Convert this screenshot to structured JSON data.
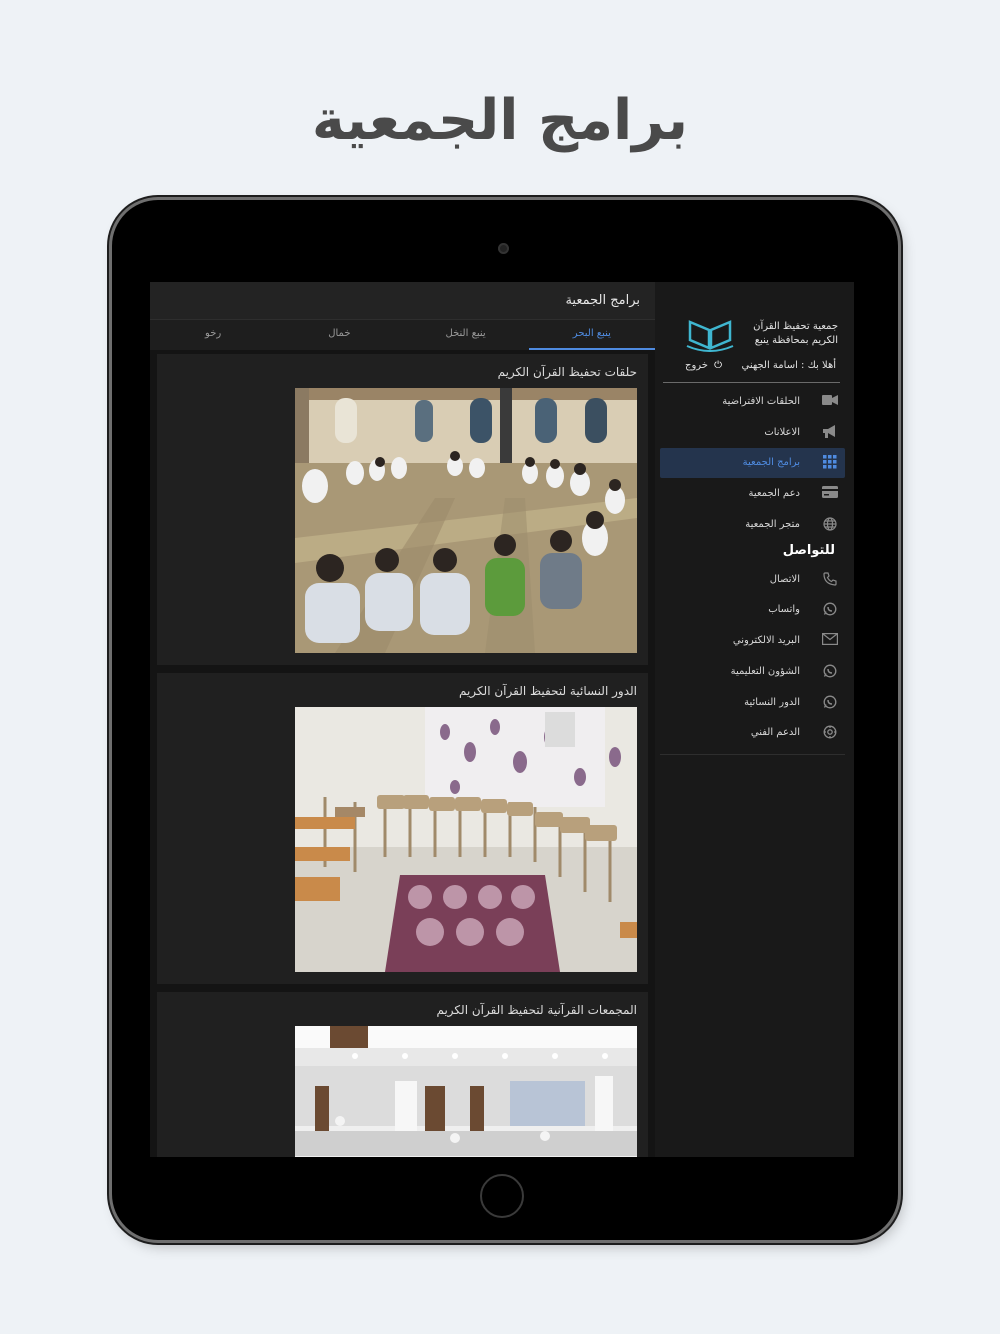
{
  "headline": "برامج الجمعية",
  "main": {
    "title": "برامج الجمعية",
    "tabs": [
      {
        "label": "ينبع البحر",
        "active": true
      },
      {
        "label": "ينبع النخل",
        "active": false
      },
      {
        "label": "خمال",
        "active": false
      },
      {
        "label": "رخو",
        "active": false
      }
    ],
    "cards": [
      {
        "title": "حلقات تحفيظ القرآن الكريم"
      },
      {
        "title": "الدور النسائية لتحفيظ القرآن الكريم"
      },
      {
        "title": "المجمعات القرآنية لتحفيظ القرآن الكريم"
      }
    ]
  },
  "sidebar": {
    "brand_name": "جمعية تحفيظ القرآن الكريم بمحافظة ينبع",
    "greeting": "أهلا بك : اسامة الجهني",
    "logout_label": "خروج",
    "menu": [
      {
        "label": "الحلقات الافتراضية",
        "icon": "video-camera-icon",
        "active": false
      },
      {
        "label": "الاعلانات",
        "icon": "megaphone-icon",
        "active": false
      },
      {
        "label": "برامج الجمعية",
        "icon": "grid-icon",
        "active": true
      },
      {
        "label": "دعم الجمعية",
        "icon": "credit-card-icon",
        "active": false
      },
      {
        "label": "متجر الجمعية",
        "icon": "globe-icon",
        "active": false
      }
    ],
    "contact_title": "للتواصل",
    "contact": [
      {
        "label": "الاتصال",
        "icon": "phone-icon"
      },
      {
        "label": "واتساب",
        "icon": "whatsapp-icon"
      },
      {
        "label": "البريد الالكتروني",
        "icon": "mail-icon"
      },
      {
        "label": "الشؤون التعليمية",
        "icon": "whatsapp-icon"
      },
      {
        "label": "الدور النسائية",
        "icon": "whatsapp-icon"
      },
      {
        "label": "الدعم الفني",
        "icon": "settings-icon"
      }
    ]
  },
  "colors": {
    "accent": "#4f8be0",
    "active_bg": "#24344d",
    "background": "#141414"
  }
}
